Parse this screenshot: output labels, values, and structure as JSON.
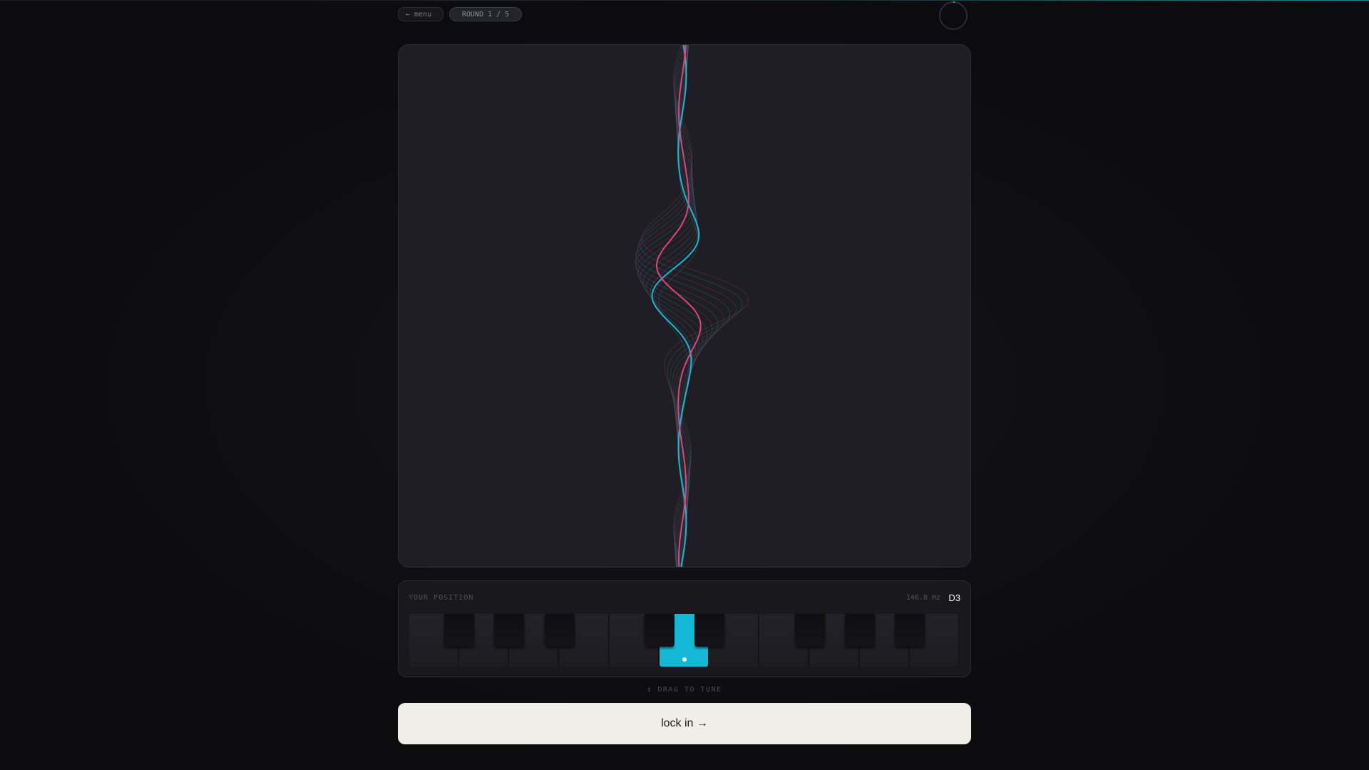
{
  "topbar": {
    "menu_label": "← menu",
    "round_label": "ROUND 1 / 5"
  },
  "position": {
    "label": "YOUR POSITION",
    "frequency": "146.8 Hz",
    "note": "D3"
  },
  "keyboard": {
    "white_keys": 11,
    "black_keys": 8,
    "active_key": "D3"
  },
  "hint": "↕ DRAG TO TUNE",
  "lock_in_label": "lock in →",
  "colors": {
    "accent": "#12b8d6",
    "wave_blue": "#1fb4cf",
    "wave_pink": "#d9477a",
    "button_bg": "#efeee9"
  }
}
